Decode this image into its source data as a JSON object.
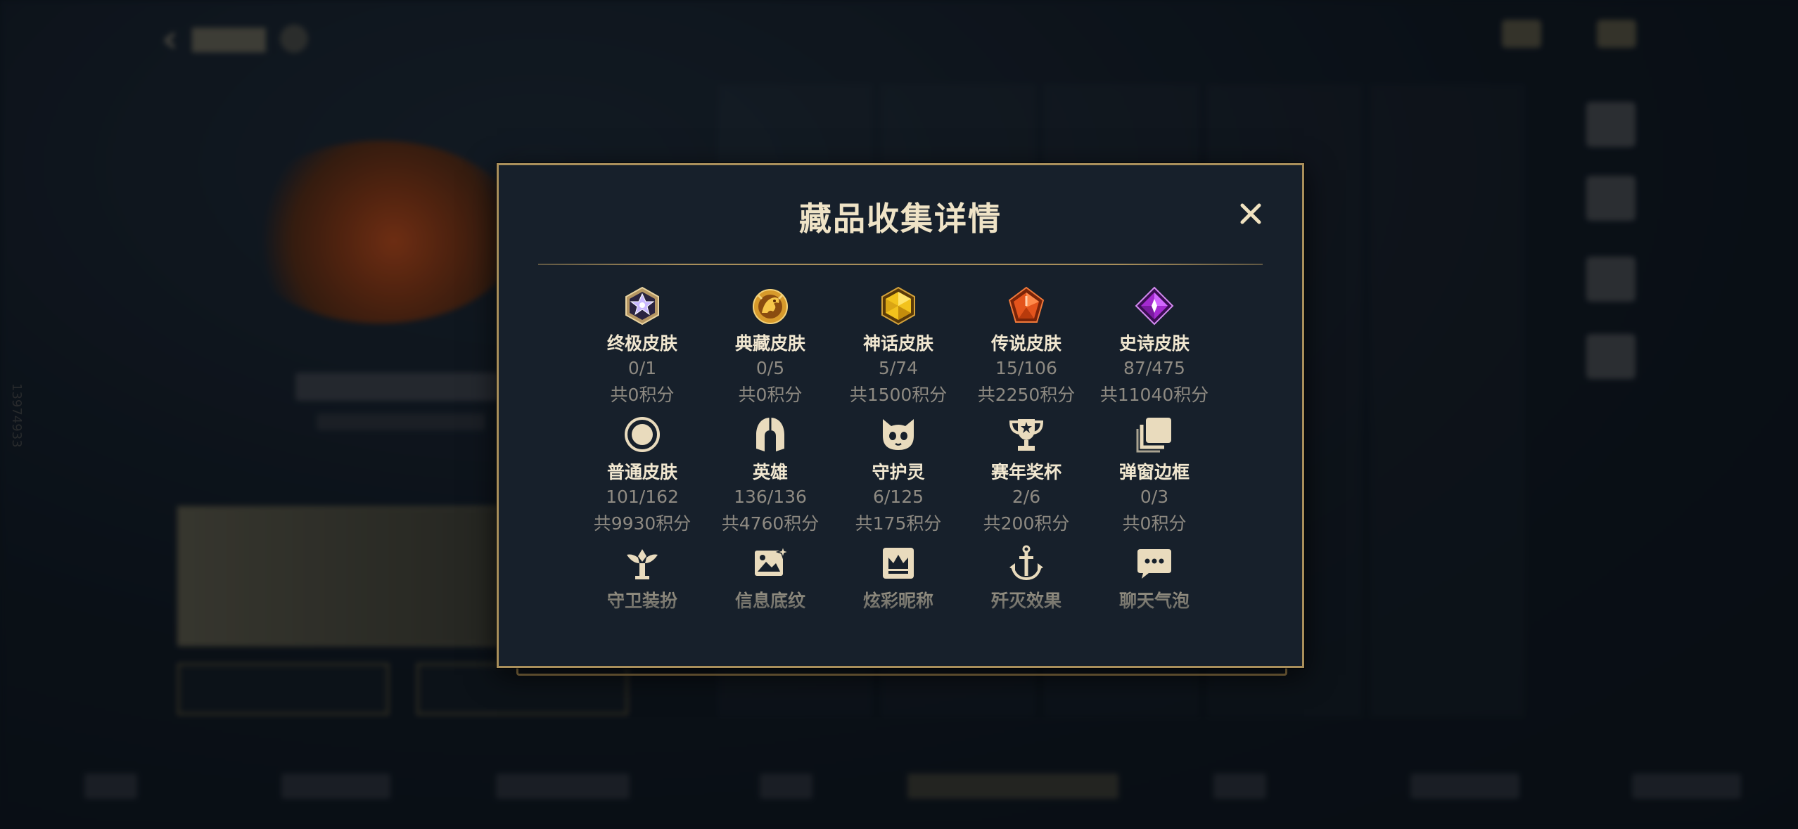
{
  "background": {
    "header_back_icon": "chevron-left-icon",
    "vertical_id": "13974933"
  },
  "modal": {
    "title": "藏品收集详情",
    "close_icon": "close-icon",
    "accent_color": "#a98f5b",
    "items": [
      {
        "label": "终极皮肤",
        "count": "0/1",
        "points": "共0积分",
        "icon": "ultimate-gem-icon"
      },
      {
        "label": "典藏皮肤",
        "count": "0/5",
        "points": "共0积分",
        "icon": "dragon-medal-icon"
      },
      {
        "label": "神话皮肤",
        "count": "5/74",
        "points": "共1500积分",
        "icon": "gold-gem-icon"
      },
      {
        "label": "传说皮肤",
        "count": "15/106",
        "points": "共2250积分",
        "icon": "orange-gem-icon"
      },
      {
        "label": "史诗皮肤",
        "count": "87/475",
        "points": "共11040积分",
        "icon": "purple-gem-icon"
      },
      {
        "label": "普通皮肤",
        "count": "101/162",
        "points": "共9930积分",
        "icon": "ring-icon"
      },
      {
        "label": "英雄",
        "count": "136/136",
        "points": "共4760积分",
        "icon": "helmet-icon"
      },
      {
        "label": "守护灵",
        "count": "6/125",
        "points": "共175积分",
        "icon": "guardian-pet-icon"
      },
      {
        "label": "赛年奖杯",
        "count": "2/6",
        "points": "共200积分",
        "icon": "trophy-icon"
      },
      {
        "label": "弹窗边框",
        "count": "0/3",
        "points": "共0积分",
        "icon": "frames-icon"
      },
      {
        "label": "守卫装扮",
        "icon": "ward-icon"
      },
      {
        "label": "信息底纹",
        "icon": "picture-icon"
      },
      {
        "label": "炫彩昵称",
        "icon": "crown-card-icon"
      },
      {
        "label": "歼灭效果",
        "icon": "anchor-icon"
      },
      {
        "label": "聊天气泡",
        "icon": "chat-bubble-icon"
      }
    ]
  }
}
